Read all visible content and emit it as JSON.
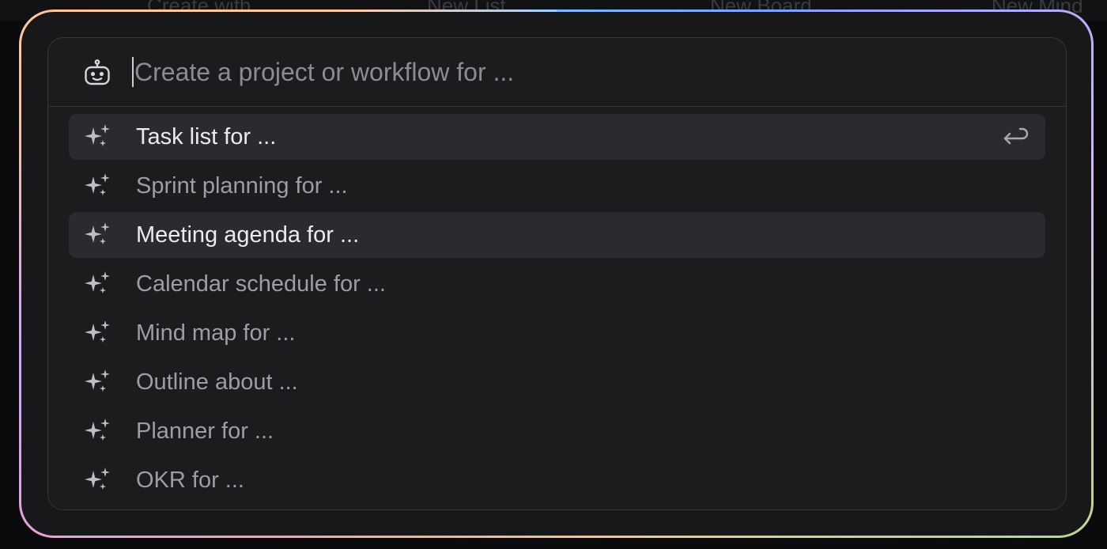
{
  "background_menu": {
    "items": [
      "Create with",
      "New List",
      "New Board",
      "New Mind"
    ]
  },
  "prompt": {
    "icon": "robot-icon",
    "value": "",
    "placeholder": "Create a project or workflow for ..."
  },
  "suggestions": [
    {
      "label": "Task list for ...",
      "icon": "sparkles-icon",
      "state": "selected",
      "shortcut_icon": "enter-return-icon"
    },
    {
      "label": "Sprint planning for ...",
      "icon": "sparkles-icon",
      "state": "normal"
    },
    {
      "label": "Meeting agenda for ...",
      "icon": "sparkles-icon",
      "state": "hover"
    },
    {
      "label": "Calendar schedule for ...",
      "icon": "sparkles-icon",
      "state": "normal"
    },
    {
      "label": "Mind map for ...",
      "icon": "sparkles-icon",
      "state": "normal"
    },
    {
      "label": "Outline about ...",
      "icon": "sparkles-icon",
      "state": "normal"
    },
    {
      "label": "Planner for ...",
      "icon": "sparkles-icon",
      "state": "normal"
    },
    {
      "label": "OKR for ...",
      "icon": "sparkles-icon",
      "state": "normal"
    }
  ],
  "colors": {
    "panel_background": "#1c1c1f",
    "highlight_row": "#2a2a2f",
    "text_muted": "#9d9da4",
    "text_active": "#ececef",
    "border_gradient": [
      "#7fb9ff",
      "#d9b7f2",
      "#e9d270",
      "#ff9eb8",
      "#ffcaa6"
    ]
  }
}
